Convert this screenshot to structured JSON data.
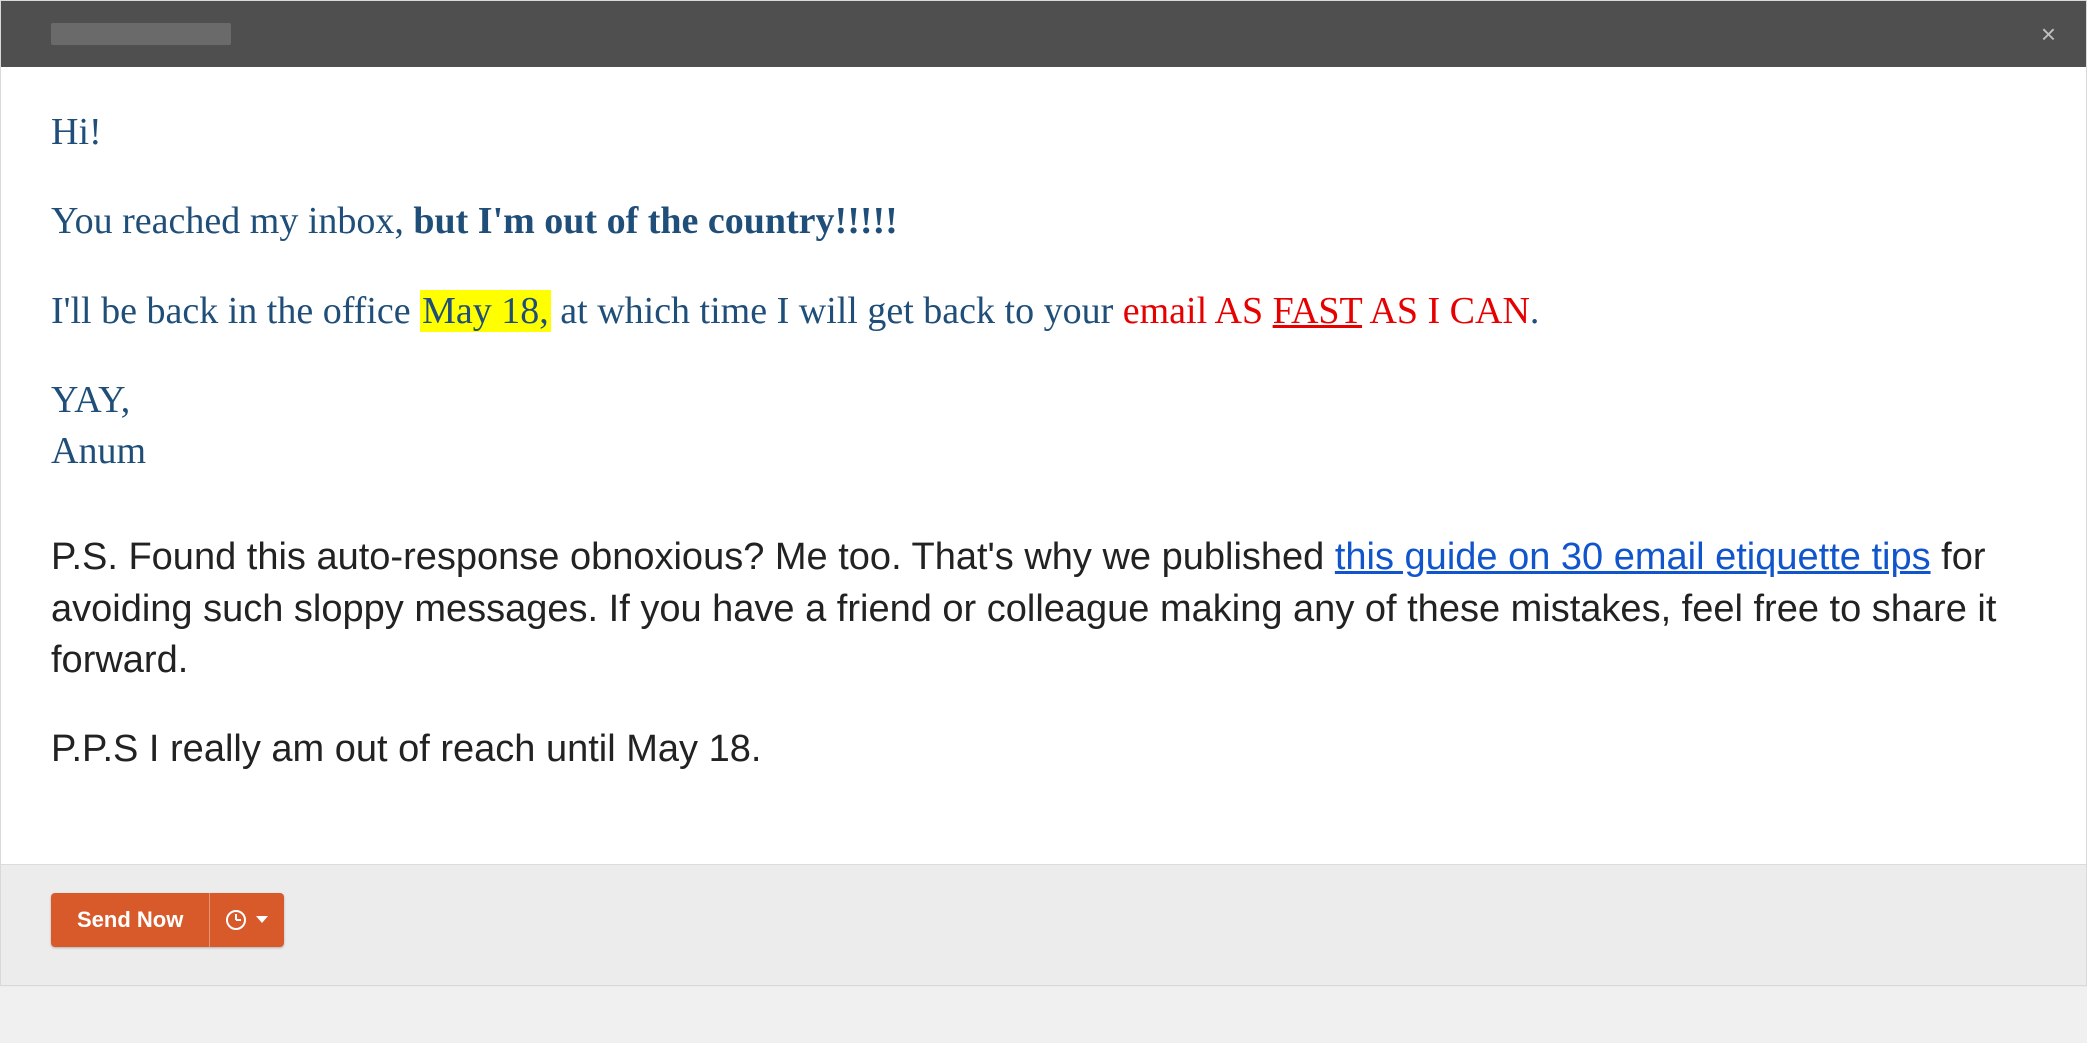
{
  "titlebar": {
    "close_glyph": "×"
  },
  "email": {
    "greeting": "Hi!",
    "line2_pre": "You reached my inbox, ",
    "line2_bold": "but I'm out of the country!!!!!",
    "line3_pre": "I'll be back in the office ",
    "line3_date_hl": "May 18,",
    "line3_mid": " at which time I will get back to your ",
    "line3_red_1": "email AS ",
    "line3_red_fast": "FAST",
    "line3_red_2": " AS I CAN",
    "line3_period": ".",
    "signoff_yay": "YAY,",
    "signoff_name": "Anum",
    "ps_pre": "P.S. Found this auto-response obnoxious? Me too. That's why we published ",
    "ps_link": "this guide on 30 email etiquette tips",
    "ps_post": " for avoiding such sloppy messages. If you have a friend or colleague making any of these mistakes, feel free to share it forward.",
    "pps": "P.P.S I really am out of reach until May 18."
  },
  "footer": {
    "send_label": "Send Now"
  }
}
